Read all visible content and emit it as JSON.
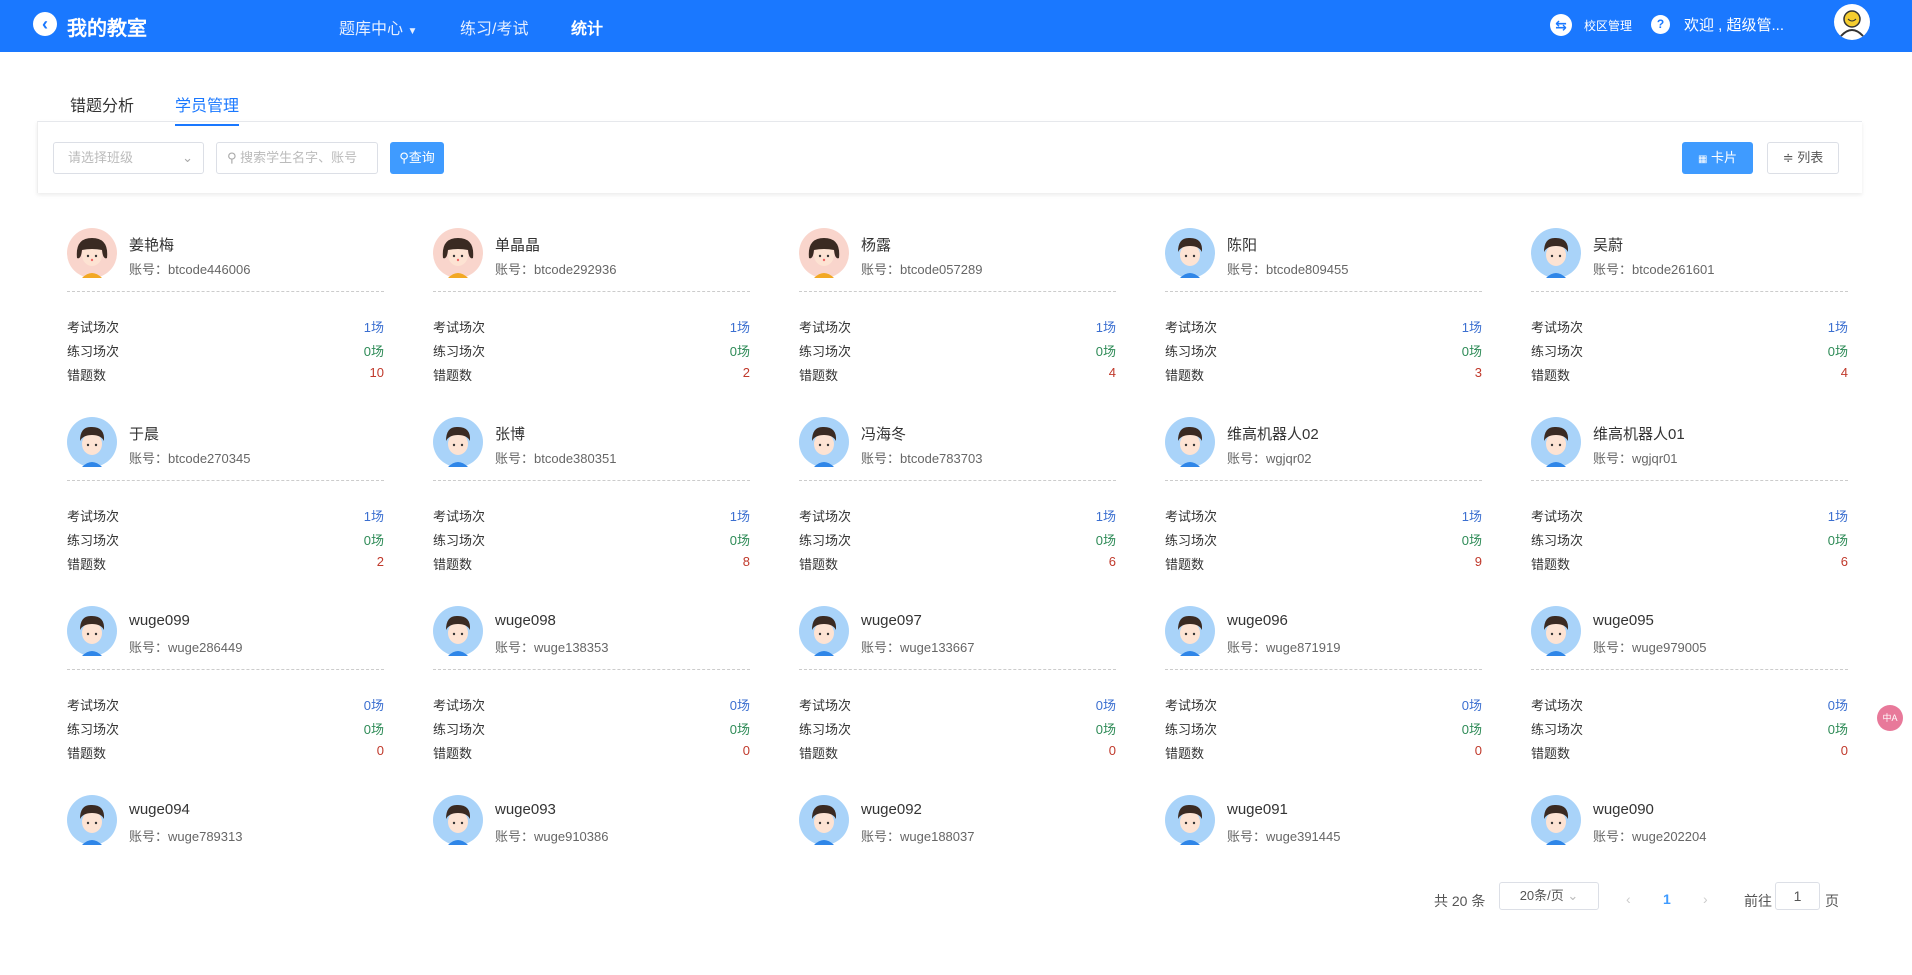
{
  "header": {
    "title": "我的教室",
    "nav": [
      "题库中心",
      "练习/考试",
      "统计"
    ],
    "campus": "校区管理",
    "welcome": "欢迎 , 超级管..."
  },
  "tabs": [
    "错题分析",
    "学员管理"
  ],
  "filter": {
    "class_placeholder": "请选择班级",
    "search_placeholder": "搜索学生名字、账号",
    "query": "查询",
    "card": "卡片",
    "list": "列表"
  },
  "labels": {
    "exam": "考试场次",
    "practice": "练习场次",
    "wrong": "错题数",
    "account_prefix": "账号："
  },
  "students": [
    {
      "name": "姜艳梅",
      "account": "btcode446006",
      "exam": "1场",
      "practice": "0场",
      "wrong": "10",
      "gender": "f"
    },
    {
      "name": "单晶晶",
      "account": "btcode292936",
      "exam": "1场",
      "practice": "0场",
      "wrong": "2",
      "gender": "f"
    },
    {
      "name": "杨露",
      "account": "btcode057289",
      "exam": "1场",
      "practice": "0场",
      "wrong": "4",
      "gender": "f"
    },
    {
      "name": "陈阳",
      "account": "btcode809455",
      "exam": "1场",
      "practice": "0场",
      "wrong": "3",
      "gender": "m"
    },
    {
      "name": "吴蔚",
      "account": "btcode261601",
      "exam": "1场",
      "practice": "0场",
      "wrong": "4",
      "gender": "m"
    },
    {
      "name": "于晨",
      "account": "btcode270345",
      "exam": "1场",
      "practice": "0场",
      "wrong": "2",
      "gender": "m"
    },
    {
      "name": "张博",
      "account": "btcode380351",
      "exam": "1场",
      "practice": "0场",
      "wrong": "8",
      "gender": "m"
    },
    {
      "name": "冯海冬",
      "account": "btcode783703",
      "exam": "1场",
      "practice": "0场",
      "wrong": "6",
      "gender": "m"
    },
    {
      "name": "维高机器人02",
      "account": "wgjqr02",
      "exam": "1场",
      "practice": "0场",
      "wrong": "9",
      "gender": "m"
    },
    {
      "name": "维高机器人01",
      "account": "wgjqr01",
      "exam": "1场",
      "practice": "0场",
      "wrong": "6",
      "gender": "m"
    },
    {
      "name": "wuge099",
      "account": "wuge286449",
      "exam": "0场",
      "practice": "0场",
      "wrong": "0",
      "gender": "m"
    },
    {
      "name": "wuge098",
      "account": "wuge138353",
      "exam": "0场",
      "practice": "0场",
      "wrong": "0",
      "gender": "m"
    },
    {
      "name": "wuge097",
      "account": "wuge133667",
      "exam": "0场",
      "practice": "0场",
      "wrong": "0",
      "gender": "m"
    },
    {
      "name": "wuge096",
      "account": "wuge871919",
      "exam": "0场",
      "practice": "0场",
      "wrong": "0",
      "gender": "m"
    },
    {
      "name": "wuge095",
      "account": "wuge979005",
      "exam": "0场",
      "practice": "0场",
      "wrong": "0",
      "gender": "m"
    },
    {
      "name": "wuge094",
      "account": "wuge789313",
      "gender": "m"
    },
    {
      "name": "wuge093",
      "account": "wuge910386",
      "gender": "m"
    },
    {
      "name": "wuge092",
      "account": "wuge188037",
      "gender": "m"
    },
    {
      "name": "wuge091",
      "account": "wuge391445",
      "gender": "m"
    },
    {
      "name": "wuge090",
      "account": "wuge202204",
      "gender": "m"
    }
  ],
  "pagination": {
    "total": "共 20 条",
    "page_size": "20条/页",
    "current": "1",
    "goto": "前往",
    "goto_value": "1",
    "page_suffix": "页"
  },
  "translate_badge": "中A"
}
